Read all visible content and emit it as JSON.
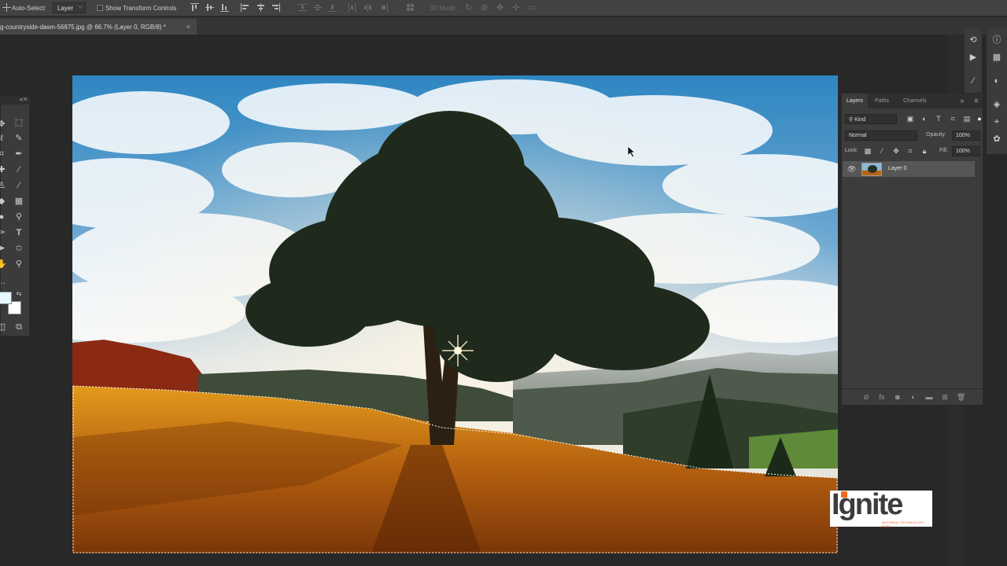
{
  "options_bar": {
    "auto_select_label": "Auto-Select:",
    "auto_select_value": "Layer",
    "show_transform_label": "Show Transform Controls",
    "mode_3d_label": "3D Mode:"
  },
  "document": {
    "tab_title": "g-countryside-dawn-56875.jpg @ 66.7% (Layer 0, RGB/8) *",
    "close_glyph": "×"
  },
  "layers_panel": {
    "tabs": [
      "Layers",
      "Paths",
      "Channels"
    ],
    "kind_label": "Kind",
    "blend_mode": "Normal",
    "opacity_label": "Opacity:",
    "opacity_value": "100%",
    "lock_label": "Lock:",
    "fill_label": "Fill:",
    "fill_value": "100%",
    "layers": [
      {
        "name": "Layer 0",
        "visible": true
      }
    ]
  },
  "watermark": {
    "word": "Ignite",
    "tagline": "NATIONAL TECHNOLOGY PARK"
  },
  "colors": {
    "foreground": "#e6f9ff",
    "background": "#ffffff",
    "ui_panel": "#3c3c3c",
    "accent_orange": "#ef6c1a"
  }
}
